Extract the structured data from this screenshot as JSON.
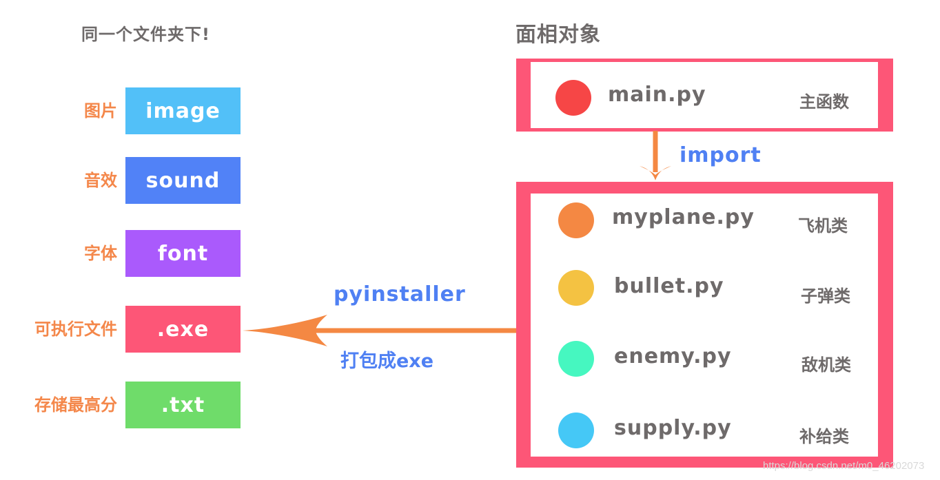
{
  "left": {
    "title": "同一个文件夹下!",
    "items": [
      {
        "label": "图片",
        "name": "image",
        "color": "#52c0f8"
      },
      {
        "label": "音效",
        "name": "sound",
        "color": "#5182f7"
      },
      {
        "label": "字体",
        "name": "font",
        "color": "#aa5afc"
      },
      {
        "label": "可执行文件",
        "name": ".exe",
        "color": "#fd5677"
      },
      {
        "label": "存储最高分",
        "name": ".txt",
        "color": "#6fdc6a"
      }
    ]
  },
  "right": {
    "title": "面相对象",
    "main": {
      "file": "main.py",
      "desc": "主函数",
      "color": "#f64646"
    },
    "import_label": "import",
    "modules": [
      {
        "file": "myplane.py",
        "desc": "飞机类",
        "color": "#f48843"
      },
      {
        "file": "bullet.py",
        "desc": "子弹类",
        "color": "#f4c242"
      },
      {
        "file": "enemy.py",
        "desc": "敌机类",
        "color": "#46f7c0"
      },
      {
        "file": "supply.py",
        "desc": "补给类",
        "color": "#45c8f6"
      }
    ]
  },
  "arrow": {
    "top_label": "pyinstaller",
    "bottom_label": "打包成exe",
    "color": "#f48843"
  },
  "colors": {
    "frame": "#fd5677",
    "heading": "#6e6a6a",
    "label": "#f4874a",
    "blue": "#4f80f3"
  },
  "watermark": "https://blog.csdn.net/m0_46202073"
}
